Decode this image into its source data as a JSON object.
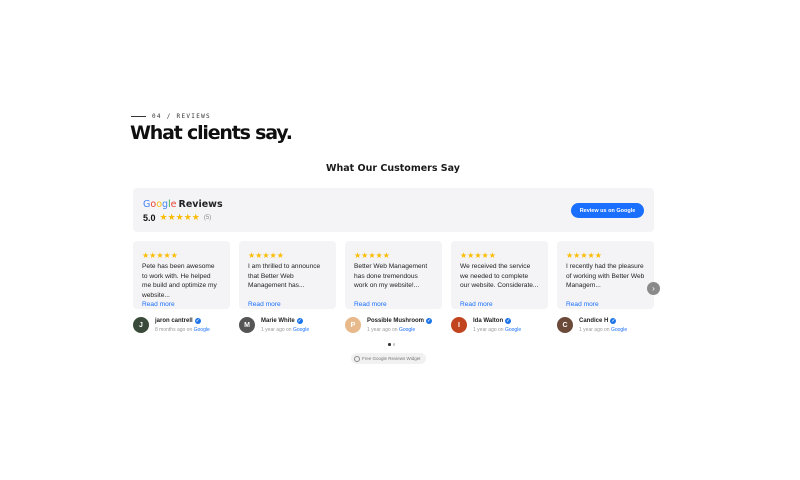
{
  "section": {
    "eyebrow": "04 / REVIEWS",
    "title": "What clients say."
  },
  "widget": {
    "title": "What Our Customers Say",
    "brand": {
      "google": "Google",
      "reviews": "Reviews"
    },
    "rating": {
      "score": "5.0",
      "stars": "★★★★★",
      "count": "(5)"
    },
    "review_button": "Review us on Google",
    "read_more": "Read more",
    "reviews": [
      {
        "text": "Pete has been awesome to work with. He helped me build and optimize my website...",
        "author": "jaron cantrell",
        "time": "8 months ago on",
        "source": "Google",
        "avatar_initial": "J",
        "avatar_color": "#3a4a3a"
      },
      {
        "text": "I am thrilled to announce that Better Web Management has...",
        "author": "Marie White",
        "time": "1 year ago on",
        "source": "Google",
        "avatar_initial": "M",
        "avatar_color": "#555555"
      },
      {
        "text": "Better Web Management has done tremendous work on my website!...",
        "author": "Possible Mushroom",
        "time": "1 year ago on",
        "source": "Google",
        "avatar_initial": "P",
        "avatar_color": "#e8b98a"
      },
      {
        "text": "We received the service we needed to complete our website. Considerate...",
        "author": "Ida Walton",
        "time": "1 year ago on",
        "source": "Google",
        "avatar_initial": "I",
        "avatar_color": "#c1441f"
      },
      {
        "text": "I recently had the pleasure of working with Better Web Managem...",
        "author": "Candice H",
        "time": "1 year ago on",
        "source": "Google",
        "avatar_initial": "C",
        "avatar_color": "#6b4a3a"
      }
    ],
    "next_arrow": "›",
    "footer_badge": "Free Google Reviews Widget",
    "colors": {
      "accent": "#1a6fff",
      "star": "#fbbc04",
      "card_bg": "#f4f4f6"
    },
    "icons": {
      "verified": "verified-check-icon",
      "next": "chevron-right-icon"
    }
  }
}
